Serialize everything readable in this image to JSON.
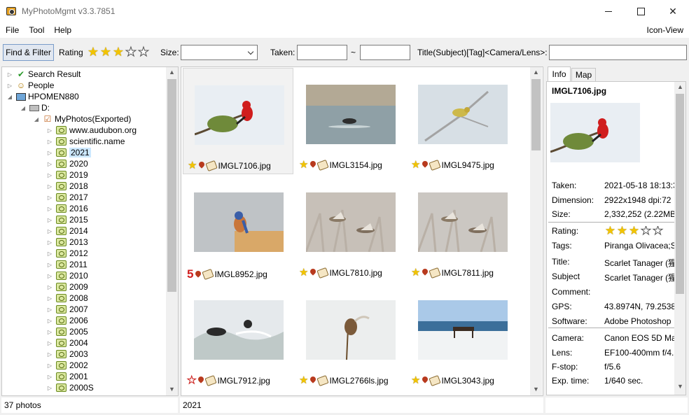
{
  "window": {
    "title": "MyPhotoMgmt v3.3.7851",
    "close_glyph": "✕"
  },
  "menu": {
    "items": [
      "File",
      "Tool",
      "Help"
    ],
    "view_label": "Icon-View"
  },
  "filter": {
    "find_button": "Find & Filter",
    "rating_label": "Rating",
    "rating_value": 3,
    "rating_max": 5,
    "size_label": "Size:",
    "size_value": "",
    "taken_label": "Taken:",
    "taken_from": "",
    "taken_separator": "~",
    "taken_to": "",
    "title_label": "Title(Subject)[Tag]<Camera/Lens>:",
    "title_value": ""
  },
  "tree": {
    "nodes": [
      {
        "label": "Search Result",
        "icon": "checkmark-icon"
      },
      {
        "label": "People",
        "icon": "people-icon"
      },
      {
        "label": "HPOMEN880",
        "icon": "computer-icon"
      },
      {
        "label": "D:",
        "icon": "drive-icon"
      },
      {
        "label": "MyPhotos(Exported)",
        "icon": "checked-folder-icon"
      },
      {
        "label": "www.audubon.org",
        "icon": "folder-icon"
      },
      {
        "label": "scientific.name",
        "icon": "folder-icon"
      },
      {
        "label": "2021",
        "icon": "folder-icon"
      },
      {
        "label": "2020",
        "icon": "folder-icon"
      },
      {
        "label": "2019",
        "icon": "folder-icon"
      },
      {
        "label": "2018",
        "icon": "folder-icon"
      },
      {
        "label": "2017",
        "icon": "folder-icon"
      },
      {
        "label": "2016",
        "icon": "folder-icon"
      },
      {
        "label": "2015",
        "icon": "folder-icon"
      },
      {
        "label": "2014",
        "icon": "folder-icon"
      },
      {
        "label": "2013",
        "icon": "folder-icon"
      },
      {
        "label": "2012",
        "icon": "folder-icon"
      },
      {
        "label": "2011",
        "icon": "folder-icon"
      },
      {
        "label": "2010",
        "icon": "folder-icon"
      },
      {
        "label": "2009",
        "icon": "folder-icon"
      },
      {
        "label": "2008",
        "icon": "folder-icon"
      },
      {
        "label": "2007",
        "icon": "folder-icon"
      },
      {
        "label": "2006",
        "icon": "folder-icon"
      },
      {
        "label": "2005",
        "icon": "folder-icon"
      },
      {
        "label": "2004",
        "icon": "folder-icon"
      },
      {
        "label": "2003",
        "icon": "folder-icon"
      },
      {
        "label": "2002",
        "icon": "folder-icon"
      },
      {
        "label": "2001",
        "icon": "folder-icon"
      },
      {
        "label": "2000S",
        "icon": "folder-icon"
      }
    ],
    "selected": "2021"
  },
  "thumbnails": [
    {
      "name": "IMGL7106.jpg",
      "rating": "star",
      "scene": "scarlet-tanager-branch"
    },
    {
      "name": "IMGL3154.jpg",
      "rating": "star",
      "scene": "duck-water"
    },
    {
      "name": "IMGL9475.jpg",
      "rating": "star",
      "scene": "yellow-bird-branch"
    },
    {
      "name": "IMGL8952.jpg",
      "rating": "5",
      "scene": "bluebird-post"
    },
    {
      "name": "IMGL7810.jpg",
      "rating": "star",
      "scene": "ducks-flying"
    },
    {
      "name": "IMGL7811.jpg",
      "rating": "star",
      "scene": "ducks-flying-2"
    },
    {
      "name": "IMGL7912.jpg",
      "rating": "red-star",
      "scene": "bird-waves"
    },
    {
      "name": "IMGL2766ls.jpg",
      "rating": "star",
      "scene": "bird-reed"
    },
    {
      "name": "IMGL3043.jpg",
      "rating": "star",
      "scene": "bench-lake"
    }
  ],
  "info": {
    "tabs": [
      "Info",
      "Map"
    ],
    "filename": "IMGL7106.jpg",
    "rating_value": 3,
    "rows": [
      {
        "key": "Taken:",
        "value": "2021-05-18 18:13:3"
      },
      {
        "key": "Dimension:",
        "value": "2922x1948 dpi:72"
      },
      {
        "key": "Size:",
        "value": "2,332,252 (2.22MB)"
      },
      {
        "key": "Rating:",
        "value": ""
      },
      {
        "key": "Tags:",
        "value": "Piranga Olivacea;Sc"
      },
      {
        "key": "Title:",
        "value": "Scarlet Tanager (猩"
      },
      {
        "key": "Subject",
        "value": "Scarlet Tanager (猩"
      },
      {
        "key": "Comment:",
        "value": ""
      },
      {
        "key": "GPS:",
        "value": "43.8974N, 79.2538'"
      },
      {
        "key": "Software:",
        "value": "Adobe Photoshop"
      },
      {
        "key": "Camera:",
        "value": "Canon EOS 5D Ma"
      },
      {
        "key": "Lens:",
        "value": "EF100-400mm f/4.5"
      },
      {
        "key": "F-stop:",
        "value": "f/5.6"
      },
      {
        "key": "Exp. time:",
        "value": "1/640 sec."
      }
    ]
  },
  "status": {
    "count": "37 photos",
    "path": "2021"
  }
}
